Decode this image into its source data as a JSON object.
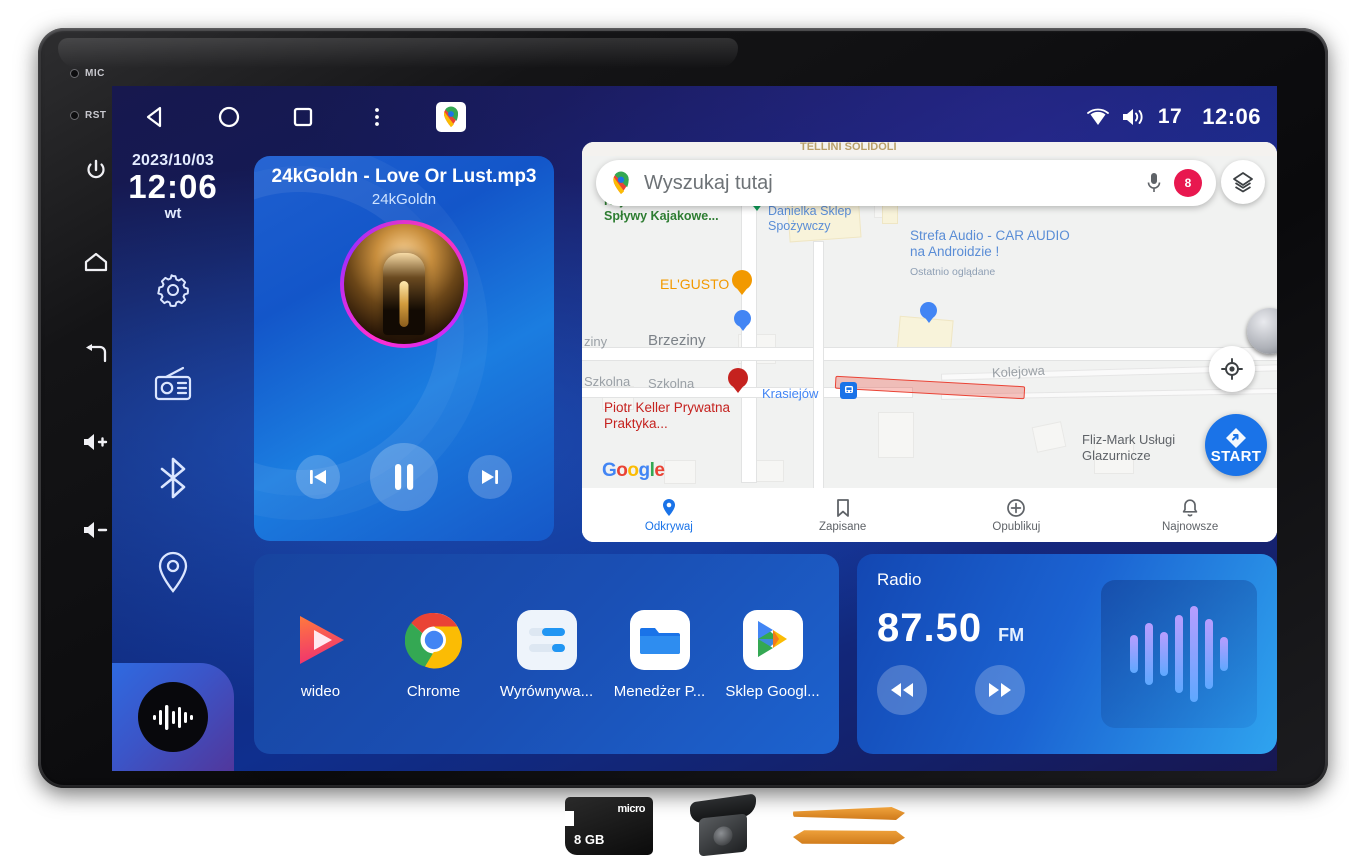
{
  "device": {
    "bezel": {
      "led_mic": "MIC",
      "led_rst": "RST",
      "buttons": [
        {
          "name": "power",
          "icon": "power-icon"
        },
        {
          "name": "home",
          "icon": "home-icon"
        },
        {
          "name": "back",
          "icon": "back-arrow-icon"
        },
        {
          "name": "volume-up",
          "icon": "volume-up-icon"
        },
        {
          "name": "volume-down",
          "icon": "volume-down-icon"
        }
      ]
    }
  },
  "statusbar": {
    "nav": [
      {
        "name": "back",
        "icon": "triangle-back-icon"
      },
      {
        "name": "home",
        "icon": "circle-home-icon"
      },
      {
        "name": "recents",
        "icon": "square-recents-icon"
      },
      {
        "name": "more",
        "icon": "three-dots-icon"
      }
    ],
    "maps_chip_icon": "google-maps-pin-icon",
    "wifi_icon": "wifi-icon",
    "volume_icon": "speaker-icon",
    "volume_level": "17",
    "clock": "12:06"
  },
  "sidebar": {
    "date": "2023/10/03",
    "time": "12:06",
    "weekday": "wt",
    "icons": [
      {
        "name": "settings",
        "icon": "gear-icon"
      },
      {
        "name": "radio",
        "icon": "radio-icon"
      },
      {
        "name": "bluetooth",
        "icon": "bluetooth-icon"
      },
      {
        "name": "navigation",
        "icon": "location-pin-icon"
      }
    ],
    "music_widget_icon": "waveform-icon"
  },
  "media": {
    "title": "24kGoldn - Love Or Lust.mp3",
    "artist": "24kGoldn",
    "controls": {
      "previous": "previous-track-icon",
      "pause": "pause-icon",
      "next": "next-track-icon"
    }
  },
  "map": {
    "clipped_top_text": "TELLINI SOLIDOLI",
    "search": {
      "placeholder": "Wyszukaj tutaj",
      "logo_icon": "google-maps-pin-icon",
      "mic_icon": "microphone-icon",
      "avatar_initial": "8"
    },
    "layers_icon": "layers-icon",
    "recenter_icon": "recenter-crosshair-icon",
    "start_button": "START",
    "google_logo": "Google",
    "pois": [
      {
        "label": "Kajaki Krasieńka - Spływy Kajakowe...",
        "color": "#2e7d32"
      },
      {
        "label": "Danielka Sklep Spożywczy",
        "color": "#4285f4"
      },
      {
        "label": "Strefa Audio - CAR AUDIO na Androidzie !",
        "sub": "Ostatnio oglądane",
        "color": "#4285f4"
      },
      {
        "label": "EL'GUSTO",
        "color": "#f29900"
      },
      {
        "label": "Piotr Keller Prywatna Praktyka...",
        "color": "#c5221f"
      },
      {
        "label": "Fliz-Mark Usługi Glazurnicze",
        "color": "#5f6368"
      }
    ],
    "streets": [
      "Brzeziny",
      "ziny",
      "Szkolna",
      "Szkolna",
      "Kolejowa"
    ],
    "place_label": "Krasiejów",
    "bottom_nav": [
      {
        "label": "Odkrywaj",
        "icon": "explore-pin-icon",
        "active": true
      },
      {
        "label": "Zapisane",
        "icon": "bookmark-icon",
        "active": false
      },
      {
        "label": "Opublikuj",
        "icon": "plus-circle-icon",
        "active": false
      },
      {
        "label": "Najnowsze",
        "icon": "bell-icon",
        "active": false
      }
    ]
  },
  "dock": {
    "apps": [
      {
        "label": "wideo",
        "icon": "video-play-icon"
      },
      {
        "label": "Chrome",
        "icon": "chrome-icon"
      },
      {
        "label": "Wyrównywa...",
        "icon": "equalizer-icon"
      },
      {
        "label": "Menedżer P...",
        "icon": "folder-icon"
      },
      {
        "label": "Sklep Googl...",
        "icon": "google-play-icon"
      }
    ]
  },
  "radio": {
    "title": "Radio",
    "frequency": "87.50",
    "band": "FM",
    "prev_icon": "rewind-icon",
    "next_icon": "fast-forward-icon",
    "visualizer_bars": [
      38,
      62,
      44,
      78,
      96,
      70,
      34
    ]
  },
  "accessories": [
    {
      "name": "microsd-card",
      "logo": "micro",
      "capacity": "8 GB"
    },
    {
      "name": "rear-camera"
    },
    {
      "name": "pry-tools"
    }
  ],
  "colors": {
    "screen_bg": "#171752",
    "card_blue": "#1a4fb4",
    "accent_blue": "#1a73e8",
    "album_ring": "#ff2fd0",
    "avatar_red": "#e8184f"
  }
}
